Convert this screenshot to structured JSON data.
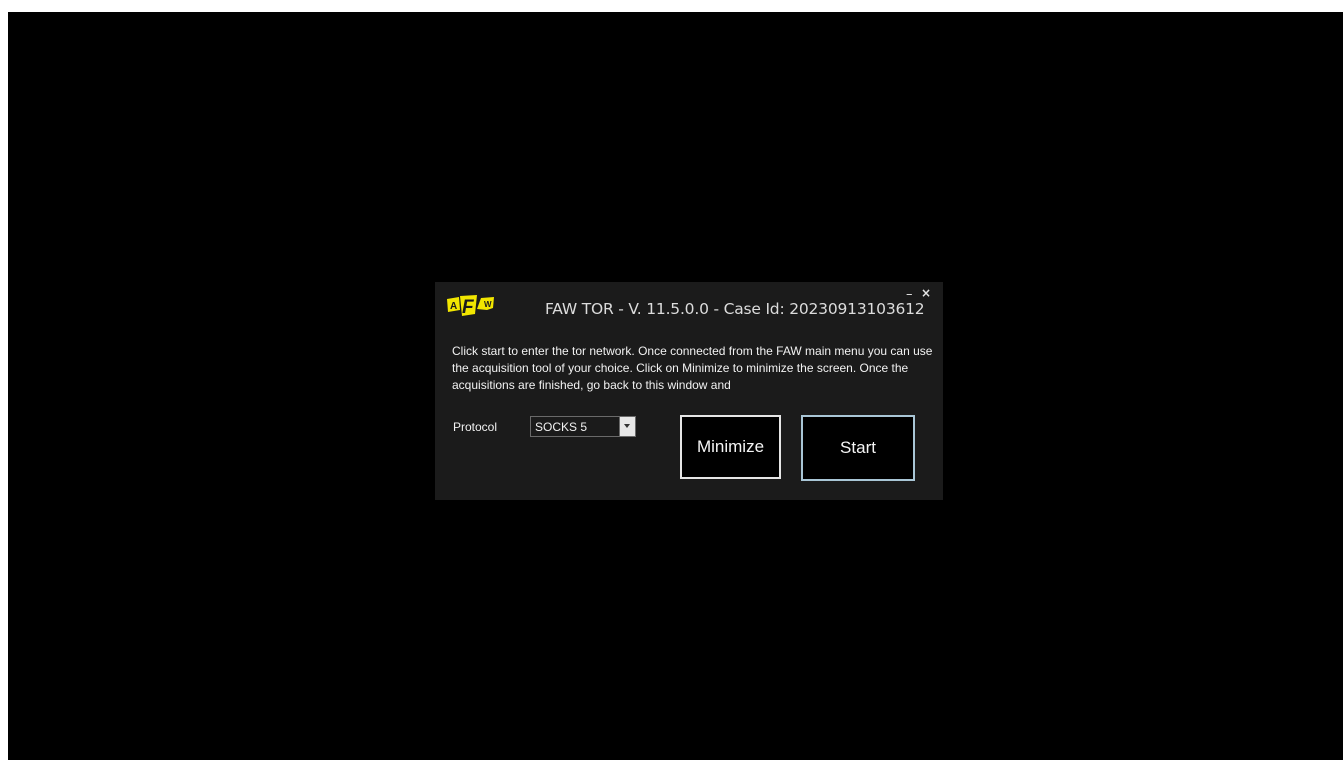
{
  "window": {
    "logo_text": "AFW",
    "title": "FAW TOR - V. 11.5.0.0 - Case Id: 20230913103612",
    "minimize_glyph": "–",
    "close_glyph": "×",
    "icons": [
      "faw-logo-icon",
      "minimize-icon",
      "close-icon",
      "chevron-down-icon"
    ]
  },
  "description": "Click start to enter the tor network. Once connected from the FAW main menu you can use the acquisition tool of your choice. Click on Minimize to minimize the screen. Once the acquisitions are finished, go back to this window and",
  "protocol": {
    "label": "Protocol",
    "selected": "SOCKS 5"
  },
  "buttons": {
    "minimize_label": "Minimize",
    "start_label": "Start"
  },
  "colors": {
    "background": "#000000",
    "dialog": "#1b1b1b",
    "logo_yellow": "#f2e600",
    "start_border": "#a9c6d6"
  }
}
